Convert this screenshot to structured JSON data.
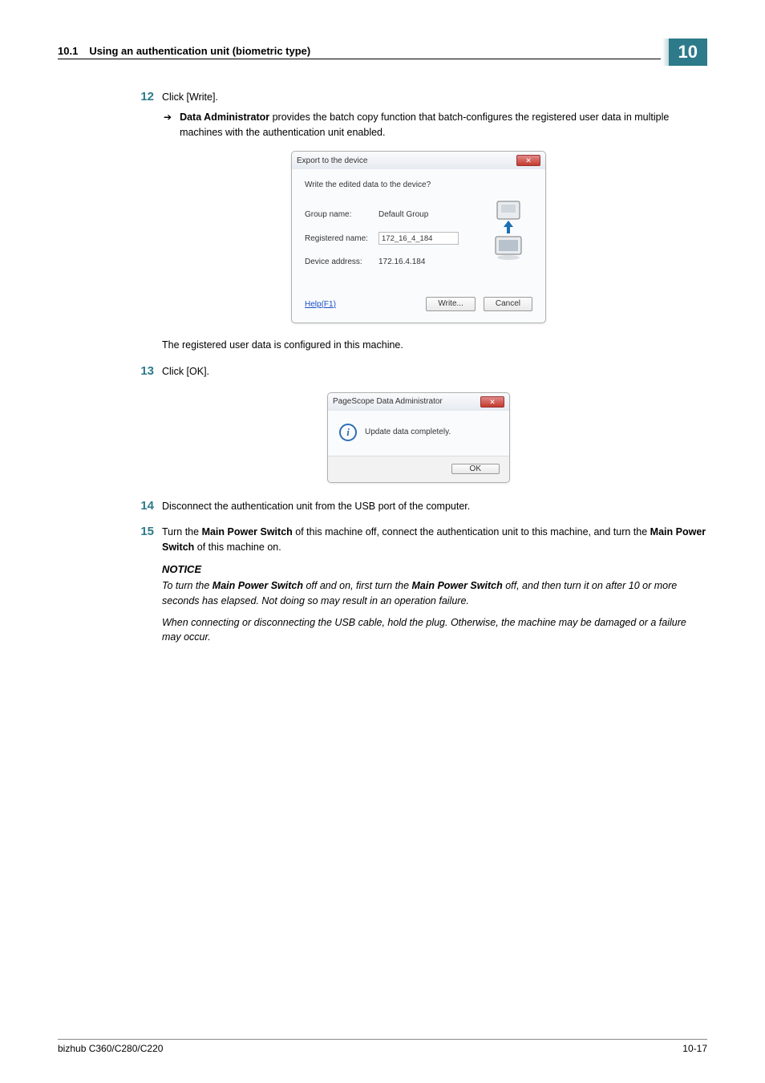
{
  "header": {
    "section_num": "10.1",
    "section_title": "Using an authentication unit (biometric type)",
    "chapter": "10"
  },
  "steps": {
    "s12": {
      "num": "12",
      "text": "Click [Write].",
      "sub": {
        "bold1": "Data Administrator",
        "text": " provides the batch copy function that batch-configures the registered user data in multiple machines with the authentication unit enabled."
      },
      "after": "The registered user data is configured in this machine."
    },
    "s13": {
      "num": "13",
      "text": "Click [OK]."
    },
    "s14": {
      "num": "14",
      "text": "Disconnect the authentication unit from the USB port of the computer."
    },
    "s15": {
      "num": "15",
      "pre": "Turn the ",
      "b1": "Main Power Switch",
      "mid1": " of this machine off, connect the authentication unit to this machine, and turn the ",
      "b2": "Main Power Switch",
      "post": " of this machine on."
    }
  },
  "notice": {
    "title": "NOTICE",
    "p1_a": "To turn the ",
    "p1_b1": "Main Power Switch",
    "p1_b": " off and on, first turn the ",
    "p1_b2": "Main Power Switch",
    "p1_c": " off, and then turn it on after 10 or more seconds has elapsed. Not doing so may result in an operation failure.",
    "p2": "When connecting or disconnecting the USB cable, hold the plug. Otherwise, the machine may be damaged or a failure may occur."
  },
  "dialog1": {
    "title": "Export to the device",
    "question": "Write the edited data to the device?",
    "group_lbl": "Group name:",
    "group_val": "Default Group",
    "reg_lbl": "Registered name:",
    "reg_val": "172_16_4_184",
    "dev_lbl": "Device address:",
    "dev_val": "172.16.4.184",
    "help": "Help(F1)",
    "write_btn": "Write...",
    "cancel_btn": "Cancel",
    "close_x": "✕"
  },
  "dialog2": {
    "title": "PageScope Data Administrator",
    "msg": "Update data completely.",
    "ok_btn": "OK",
    "close_x": "✕"
  },
  "footer": {
    "left": "bizhub C360/C280/C220",
    "right": "10-17"
  }
}
